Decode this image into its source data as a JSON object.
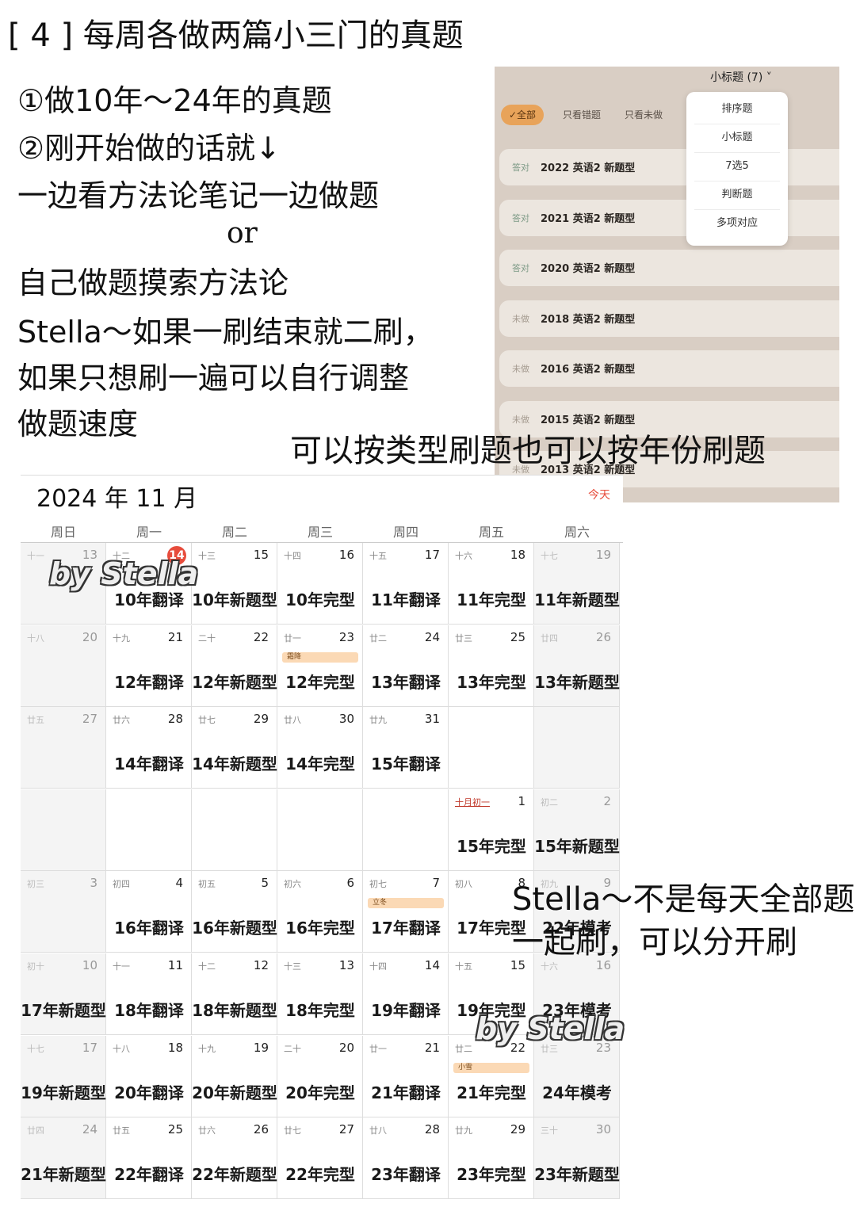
{
  "page_title": "[ 4 ] 每周各做两篇小三门的真题",
  "notes": {
    "line1": "①做10年～24年的真题",
    "line2": "②刚开始做的话就↓",
    "line3": "一边看方法论笔记一边做题",
    "line4": "or",
    "line5": "自己做题摸索方法论",
    "line6": "Stella～如果一刷结束就二刷，",
    "line7": "如果只想刷一遍可以自行调整",
    "line8": "做题速度"
  },
  "caption_1": "可以按类型刷题也可以按年份刷题",
  "caption_2_line1": "Stella～不是每天全部题",
  "caption_2_line2": "一起刷，可以分开刷",
  "watermark": "by Stella",
  "app": {
    "dropdown": "小标题 (7) ˅",
    "filters": [
      "✓全部",
      "只看错题",
      "只看未做"
    ],
    "menu": [
      "排序题",
      "小标题",
      "7选5",
      "判断题",
      "多项对应"
    ],
    "rows": [
      {
        "tag": "答对",
        "title": "2022 英语2 新题型"
      },
      {
        "tag": "答对",
        "title": "2021 英语2 新题型"
      },
      {
        "tag": "答对",
        "title": "2020 英语2 新题型"
      },
      {
        "tag": "未做",
        "title": "2018 英语2 新题型"
      },
      {
        "tag": "未做",
        "title": "2016 英语2 新题型"
      },
      {
        "tag": "未做",
        "title": "2015 英语2 新题型"
      },
      {
        "tag": "未做",
        "title": "2013 英语2 新题型"
      }
    ]
  },
  "calendar": {
    "title": "2024 年 11 月",
    "today_button": "今天",
    "weekdays": [
      "周日",
      "周一",
      "周二",
      "周三",
      "周四",
      "周五",
      "周六"
    ],
    "weeks": [
      [
        {
          "lunar": "十一",
          "day": "13",
          "plan": ""
        },
        {
          "lunar": "十二",
          "day": "14",
          "plan": "10年翻译",
          "today": true
        },
        {
          "lunar": "十三",
          "day": "15",
          "plan": "10年新题型"
        },
        {
          "lunar": "十四",
          "day": "16",
          "plan": "10年完型"
        },
        {
          "lunar": "十五",
          "day": "17",
          "plan": "11年翻译"
        },
        {
          "lunar": "十六",
          "day": "18",
          "plan": "11年完型"
        },
        {
          "lunar": "十七",
          "day": "19",
          "plan": "11年新题型"
        }
      ],
      [
        {
          "lunar": "十八",
          "day": "20",
          "plan": ""
        },
        {
          "lunar": "十九",
          "day": "21",
          "plan": "12年翻译"
        },
        {
          "lunar": "二十",
          "day": "22",
          "plan": "12年新题型"
        },
        {
          "lunar": "廿一",
          "day": "23",
          "plan": "12年完型",
          "event": "霜降"
        },
        {
          "lunar": "廿二",
          "day": "24",
          "plan": "13年翻译"
        },
        {
          "lunar": "廿三",
          "day": "25",
          "plan": "13年完型"
        },
        {
          "lunar": "廿四",
          "day": "26",
          "plan": "13年新题型"
        }
      ],
      [
        {
          "lunar": "廿五",
          "day": "27",
          "plan": ""
        },
        {
          "lunar": "廿六",
          "day": "28",
          "plan": "14年翻译"
        },
        {
          "lunar": "廿七",
          "day": "29",
          "plan": "14年新题型"
        },
        {
          "lunar": "廿八",
          "day": "30",
          "plan": "14年完型"
        },
        {
          "lunar": "廿九",
          "day": "31",
          "plan": "15年翻译"
        },
        {
          "lunar": "",
          "day": "",
          "plan": ""
        },
        {
          "lunar": "",
          "day": "",
          "plan": ""
        }
      ],
      [
        {
          "lunar": "",
          "day": "",
          "plan": ""
        },
        {
          "lunar": "",
          "day": "",
          "plan": ""
        },
        {
          "lunar": "",
          "day": "",
          "plan": ""
        },
        {
          "lunar": "",
          "day": "",
          "plan": ""
        },
        {
          "lunar": "",
          "day": "",
          "plan": ""
        },
        {
          "lunar": "十月初一",
          "day": "1",
          "plan": "15年完型",
          "month_start": true
        },
        {
          "lunar": "初二",
          "day": "2",
          "plan": "15年新题型"
        }
      ],
      [
        {
          "lunar": "初三",
          "day": "3",
          "plan": ""
        },
        {
          "lunar": "初四",
          "day": "4",
          "plan": "16年翻译"
        },
        {
          "lunar": "初五",
          "day": "5",
          "plan": "16年新题型"
        },
        {
          "lunar": "初六",
          "day": "6",
          "plan": "16年完型"
        },
        {
          "lunar": "初七",
          "day": "7",
          "plan": "17年翻译",
          "event": "立冬"
        },
        {
          "lunar": "初八",
          "day": "8",
          "plan": "17年完型"
        },
        {
          "lunar": "初九",
          "day": "9",
          "plan": "22年模考"
        }
      ],
      [
        {
          "lunar": "初十",
          "day": "10",
          "plan": "17年新题型"
        },
        {
          "lunar": "十一",
          "day": "11",
          "plan": "18年翻译"
        },
        {
          "lunar": "十二",
          "day": "12",
          "plan": "18年新题型"
        },
        {
          "lunar": "十三",
          "day": "13",
          "plan": "18年完型"
        },
        {
          "lunar": "十四",
          "day": "14",
          "plan": "19年翻译"
        },
        {
          "lunar": "十五",
          "day": "15",
          "plan": "19年完型"
        },
        {
          "lunar": "十六",
          "day": "16",
          "plan": "23年模考"
        }
      ],
      [
        {
          "lunar": "十七",
          "day": "17",
          "plan": "19年新题型"
        },
        {
          "lunar": "十八",
          "day": "18",
          "plan": "20年翻译"
        },
        {
          "lunar": "十九",
          "day": "19",
          "plan": "20年新题型"
        },
        {
          "lunar": "二十",
          "day": "20",
          "plan": "20年完型"
        },
        {
          "lunar": "廿一",
          "day": "21",
          "plan": "21年翻译"
        },
        {
          "lunar": "廿二",
          "day": "22",
          "plan": "21年完型",
          "event": "小雪"
        },
        {
          "lunar": "廿三",
          "day": "23",
          "plan": "24年模考"
        }
      ],
      [
        {
          "lunar": "廿四",
          "day": "24",
          "plan": "21年新题型"
        },
        {
          "lunar": "廿五",
          "day": "25",
          "plan": "22年翻译"
        },
        {
          "lunar": "廿六",
          "day": "26",
          "plan": "22年新题型"
        },
        {
          "lunar": "廿七",
          "day": "27",
          "plan": "22年完型"
        },
        {
          "lunar": "廿八",
          "day": "28",
          "plan": "23年翻译"
        },
        {
          "lunar": "廿九",
          "day": "29",
          "plan": "23年完型"
        },
        {
          "lunar": "三十",
          "day": "30",
          "plan": "23年新题型"
        }
      ]
    ]
  }
}
